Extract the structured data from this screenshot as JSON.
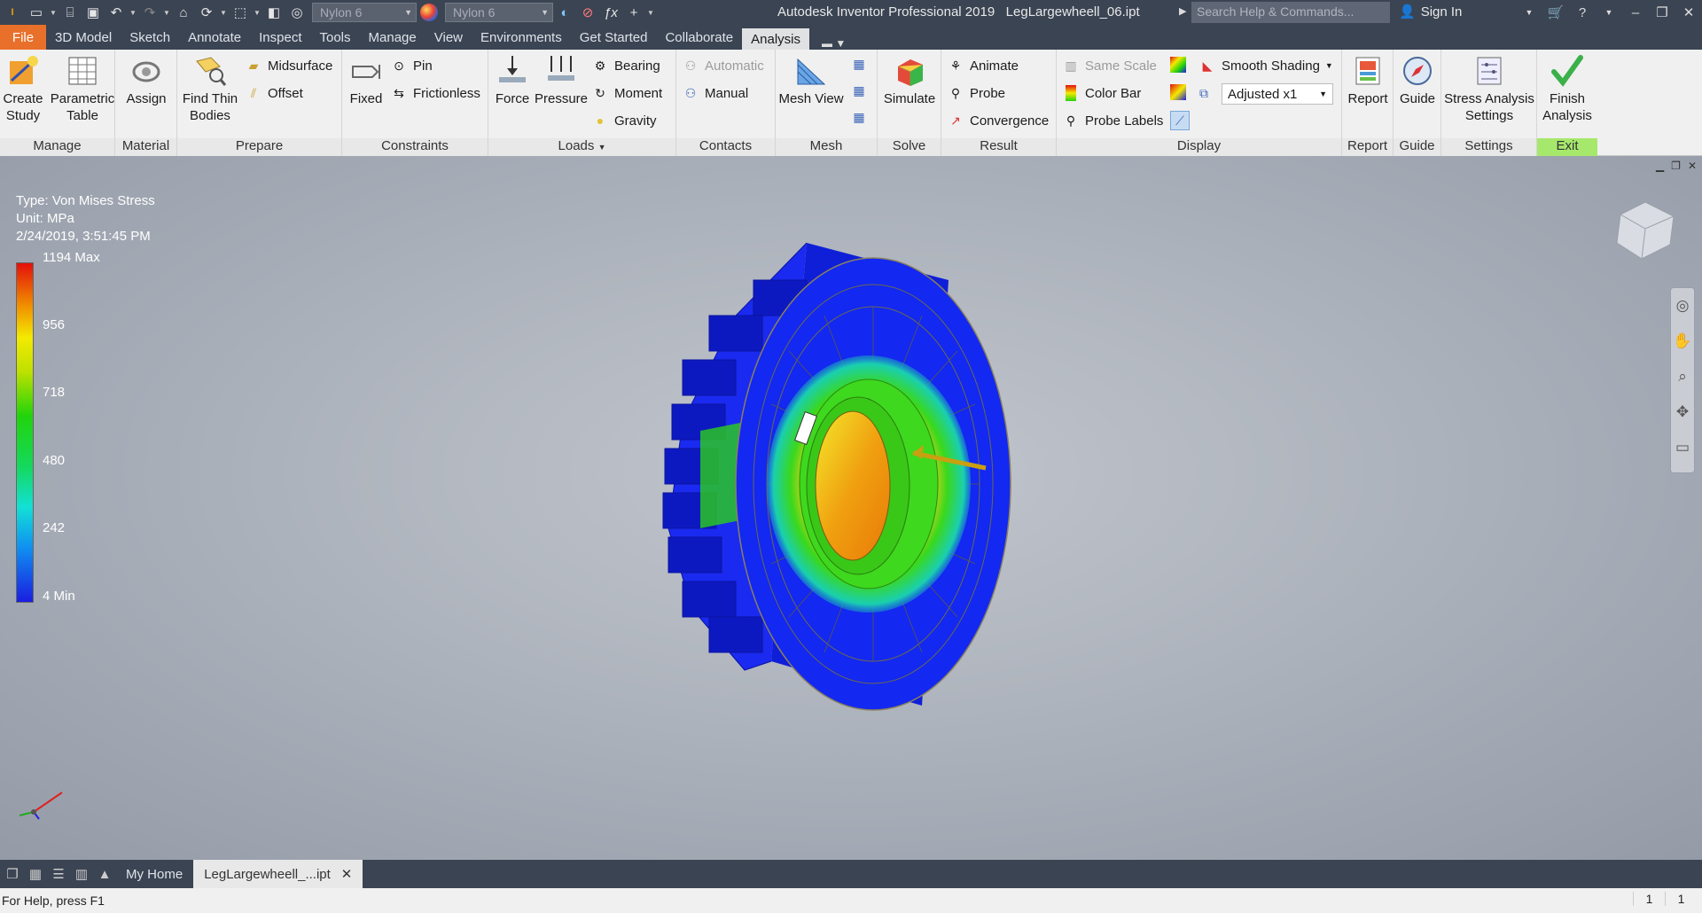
{
  "app": {
    "logo_text": "I",
    "title": "Autodesk Inventor Professional 2019",
    "document": "LegLargewheell_06.ipt",
    "search_placeholder": "Search Help & Commands...",
    "sign_in": "Sign In"
  },
  "qat": {
    "material": "Nylon 6",
    "appearance": "Nylon 6"
  },
  "menu": {
    "tabs": [
      "File",
      "3D Model",
      "Sketch",
      "Annotate",
      "Inspect",
      "Tools",
      "Manage",
      "View",
      "Environments",
      "Get Started",
      "Collaborate",
      "Analysis"
    ],
    "active": "Analysis"
  },
  "ribbon": {
    "manage": {
      "title": "Manage",
      "create_study": "Create\nStudy",
      "parametric_table": "Parametric\nTable"
    },
    "material": {
      "title": "Material",
      "assign": "Assign"
    },
    "prepare": {
      "title": "Prepare",
      "find_thin_bodies": "Find Thin\nBodies",
      "midsurface": "Midsurface",
      "offset": "Offset"
    },
    "constraints": {
      "title": "Constraints",
      "fixed": "Fixed",
      "pin": "Pin",
      "frictionless": "Frictionless"
    },
    "loads": {
      "title": "Loads",
      "force": "Force",
      "pressure": "Pressure",
      "bearing": "Bearing",
      "moment": "Moment",
      "gravity": "Gravity"
    },
    "contacts": {
      "title": "Contacts",
      "automatic": "Automatic",
      "manual": "Manual"
    },
    "mesh": {
      "title": "Mesh",
      "mesh_view": "Mesh View"
    },
    "solve": {
      "title": "Solve",
      "simulate": "Simulate"
    },
    "result": {
      "title": "Result",
      "animate": "Animate",
      "probe": "Probe",
      "convergence": "Convergence"
    },
    "display": {
      "title": "Display",
      "same_scale": "Same Scale",
      "color_bar": "Color Bar",
      "probe_labels": "Probe Labels",
      "shading": "Smooth Shading",
      "adjust": "Adjusted x1"
    },
    "report": {
      "title": "Report",
      "report": "Report"
    },
    "guide": {
      "title": "Guide",
      "guide": "Guide"
    },
    "settings": {
      "title": "Settings",
      "stress_settings": "Stress Analysis\nSettings"
    },
    "exit": {
      "title": "Exit",
      "finish": "Finish\nAnalysis"
    }
  },
  "legend": {
    "type": "Type: Von Mises Stress",
    "unit": "Unit: MPa",
    "timestamp": "2/24/2019, 3:51:45 PM",
    "labels": [
      "1194 Max",
      "956",
      "718",
      "480",
      "242",
      "4 Min"
    ]
  },
  "tabs": {
    "home": "My Home",
    "doc": "LegLargewheell_...ipt"
  },
  "status": {
    "help": "For Help, press F1",
    "n1": "1",
    "n2": "1"
  },
  "colors": {
    "title_bg": "#3b4453",
    "file_tab": "#e8702a",
    "exit_panel": "#a6e86b"
  }
}
